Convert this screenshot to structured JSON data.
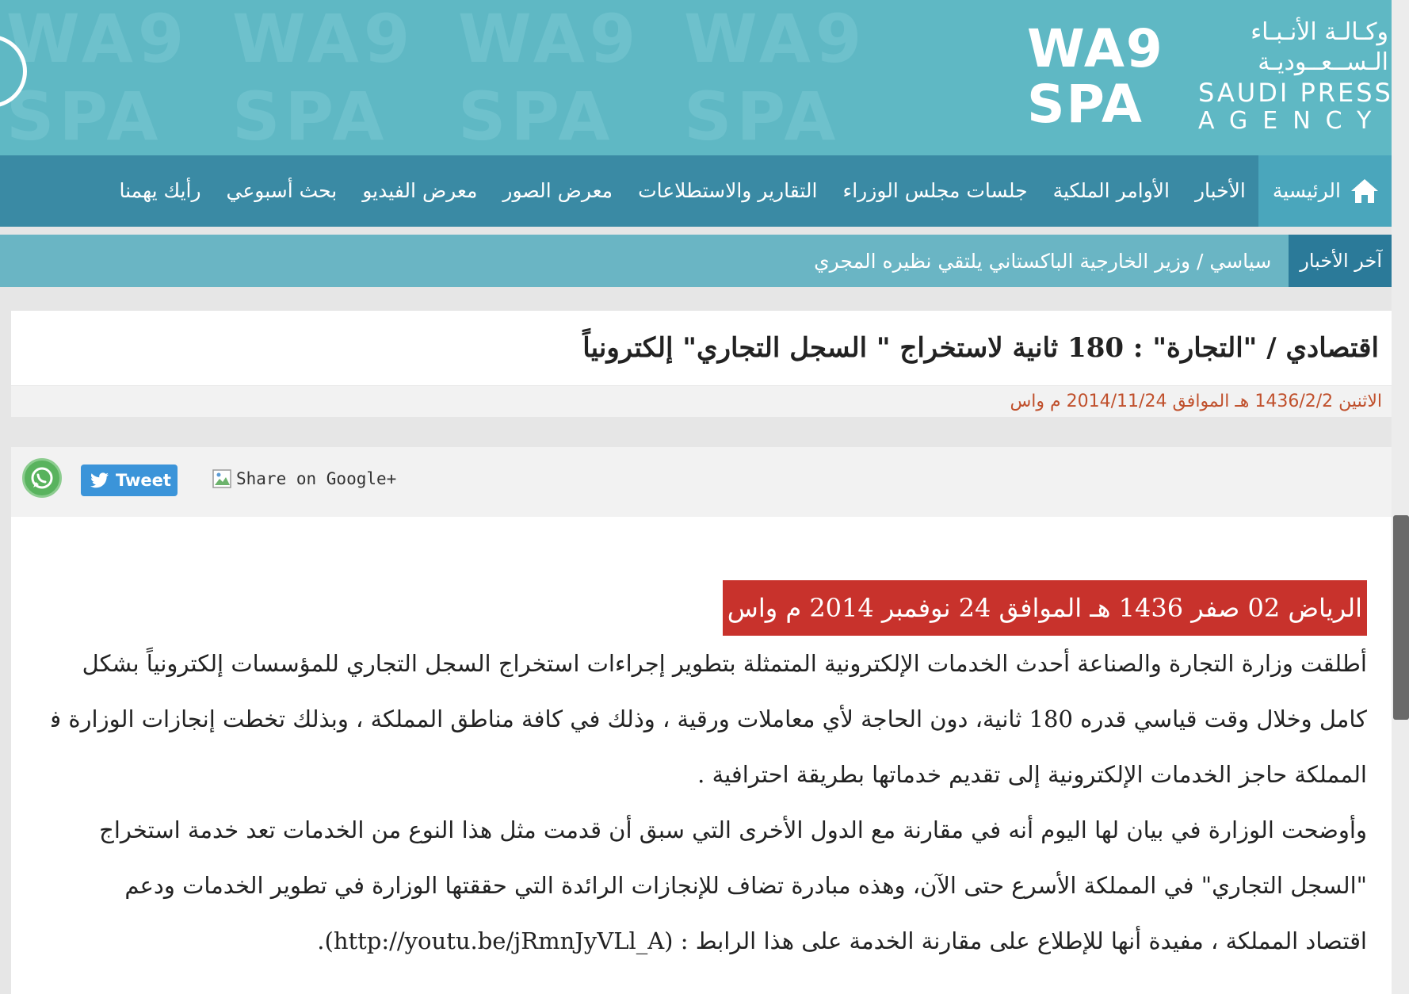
{
  "header": {
    "pattern_text": [
      "WA9",
      "WA9",
      "WA9",
      "WA9",
      "SPA",
      "SPA",
      "SPA",
      "SPA"
    ],
    "logo_mark_line1": "WA9",
    "logo_mark_line2": "SPA",
    "logo_arabic_line1": "وكـالـة الأنـبـاء",
    "logo_arabic_line2": "الـســعــوديـة",
    "logo_english_line1": "SAUDI PRESS",
    "logo_english_line2": "AGENCY"
  },
  "nav": {
    "items": [
      {
        "label": "الرئيسية"
      },
      {
        "label": "الأخبار"
      },
      {
        "label": "الأوامر الملكية"
      },
      {
        "label": "جلسات مجلس الوزراء"
      },
      {
        "label": "التقارير والاستطلاعات"
      },
      {
        "label": "معرض الصور"
      },
      {
        "label": "معرض الفيديو"
      },
      {
        "label": "بحث أسبوعي"
      },
      {
        "label": "رأيك يهمنا"
      }
    ]
  },
  "ticker": {
    "label": "آخر الأخبار",
    "headline": "سياسي / وزير الخارجية الباكستاني يلتقي نظيره المجري"
  },
  "article": {
    "title": "اقتصادي / \"التجارة\" : 180 ثانية لاستخراج \" السجل التجاري\" إلكترونياً",
    "date": "الاثنين 1436/2/2 هـ الموافق 2014/11/24 م واس",
    "dateline": "الرياض 02 صفر 1436 هـ الموافق 24 نوفمبر 2014 م واس",
    "paragraph1_lines": [
      "أطلقت وزارة التجارة والصناعة أحدث الخدمات الإلكترونية المتمثلة بتطوير إجراءات استخراج السجل التجاري للمؤسسات إلكترونياً بشكل",
      "كامل وخلال وقت قياسي قدره 180 ثانية، دون الحاجة لأي معاملات ورقية ، وذلك في كافة مناطق المملكة ، وبذلك تخطت إنجازات الوزارة في",
      "المملكة حاجز الخدمات الإلكترونية إلى تقديم خدماتها بطريقة احترافية ."
    ],
    "paragraph2_lines": [
      "وأوضحت الوزارة في بيان لها اليوم أنه في مقارنة مع الدول الأخرى التي سبق أن قدمت مثل هذا النوع من الخدمات تعد خدمة استخراج",
      "\"السجل التجاري\" في المملكة الأسرع حتى الآن، وهذه مبادرة تضاف للإنجازات الرائدة التي حققتها الوزارة في تطوير الخدمات ودعم",
      "اقتصاد المملكة ، مفيدة أنها للإطلاع على مقارنة الخدمة على هذا الرابط : (http://youtu.be/jRmnJyVLl_A)."
    ]
  },
  "share": {
    "tweet_label": "Tweet",
    "gplus_alt": "Share on Google+"
  },
  "colors": {
    "banner": "#5fb8c4",
    "nav": "#3a8aa4",
    "nav_active": "#4aa6bc",
    "ticker": "#6ab5c4",
    "ticker_label": "#2b7a99",
    "date_text": "#c0502c",
    "dateline_bg": "#c8322c",
    "tweet": "#3b94d9",
    "whatsapp": "#59b35e"
  }
}
